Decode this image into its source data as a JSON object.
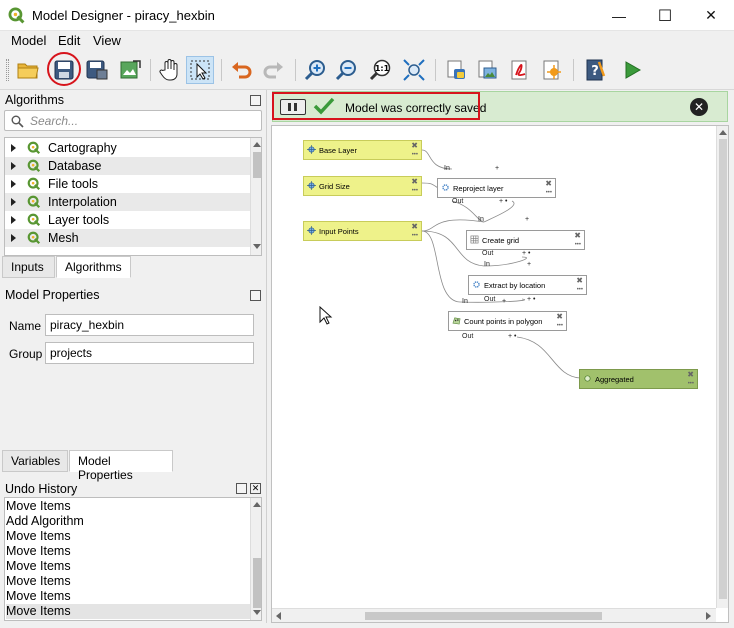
{
  "window": {
    "title": "Model Designer - piracy_hexbin",
    "minimize": "—",
    "maximize": "☐",
    "close": "✕"
  },
  "menu": [
    "Model",
    "Edit",
    "View"
  ],
  "algorithms_panel": {
    "title": "Algorithms",
    "search_placeholder": "Search...",
    "items": [
      "Cartography",
      "Database",
      "File tools",
      "Interpolation",
      "Layer tools",
      "Mesh"
    ]
  },
  "tabs_top": [
    "Inputs",
    "Algorithms"
  ],
  "model_properties": {
    "title": "Model Properties",
    "name_label": "Name",
    "name_value": "piracy_hexbin",
    "group_label": "Group",
    "group_value": "projects"
  },
  "tabs_bottom": [
    "Variables",
    "Model Properties"
  ],
  "undo_history": {
    "title": "Undo History",
    "items": [
      "Move Items",
      "Add Algorithm",
      "Move Items",
      "Move Items",
      "Move Items",
      "Move Items",
      "Move Items",
      "Move Items"
    ]
  },
  "message": {
    "text": "Model was correctly saved"
  },
  "model": {
    "inputs": [
      "Base Layer",
      "Grid Size",
      "Input Points"
    ],
    "algorithms": [
      "Reproject layer",
      "Create grid",
      "Extract by location",
      "Count points in polygon"
    ],
    "output": "Aggregated",
    "port_in": "In",
    "port_out": "Out"
  },
  "colors": {
    "accent_red": "#d7141c",
    "input_node": "#eef28a",
    "output_node": "#a1c16c",
    "message_bg": "#d8ebd1",
    "qgis_green": "#589632"
  }
}
